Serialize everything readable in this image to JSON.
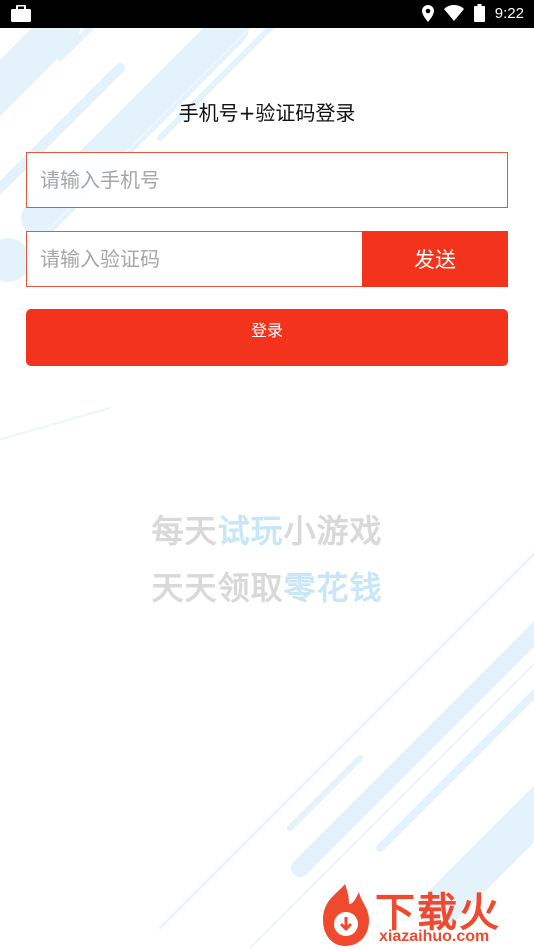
{
  "status_bar": {
    "time": "9:22"
  },
  "login": {
    "title": "手机号+验证码登录",
    "phone_placeholder": "请输入手机号",
    "code_placeholder": "请输入验证码",
    "send_label": "发送",
    "login_label": "登录"
  },
  "slogan": {
    "line1_a": "每天",
    "line1_b": "试玩",
    "line1_c": "小游戏",
    "line2_a": "天天领取",
    "line2_b": "零花钱"
  },
  "watermark": {
    "brand": "下载火",
    "url": "xiazaihuo.com"
  },
  "colors": {
    "accent": "#f4331d",
    "input_border": "#e8553f",
    "slogan_gray": "#d9d9d9",
    "slogan_blue": "#c7e6f7"
  }
}
